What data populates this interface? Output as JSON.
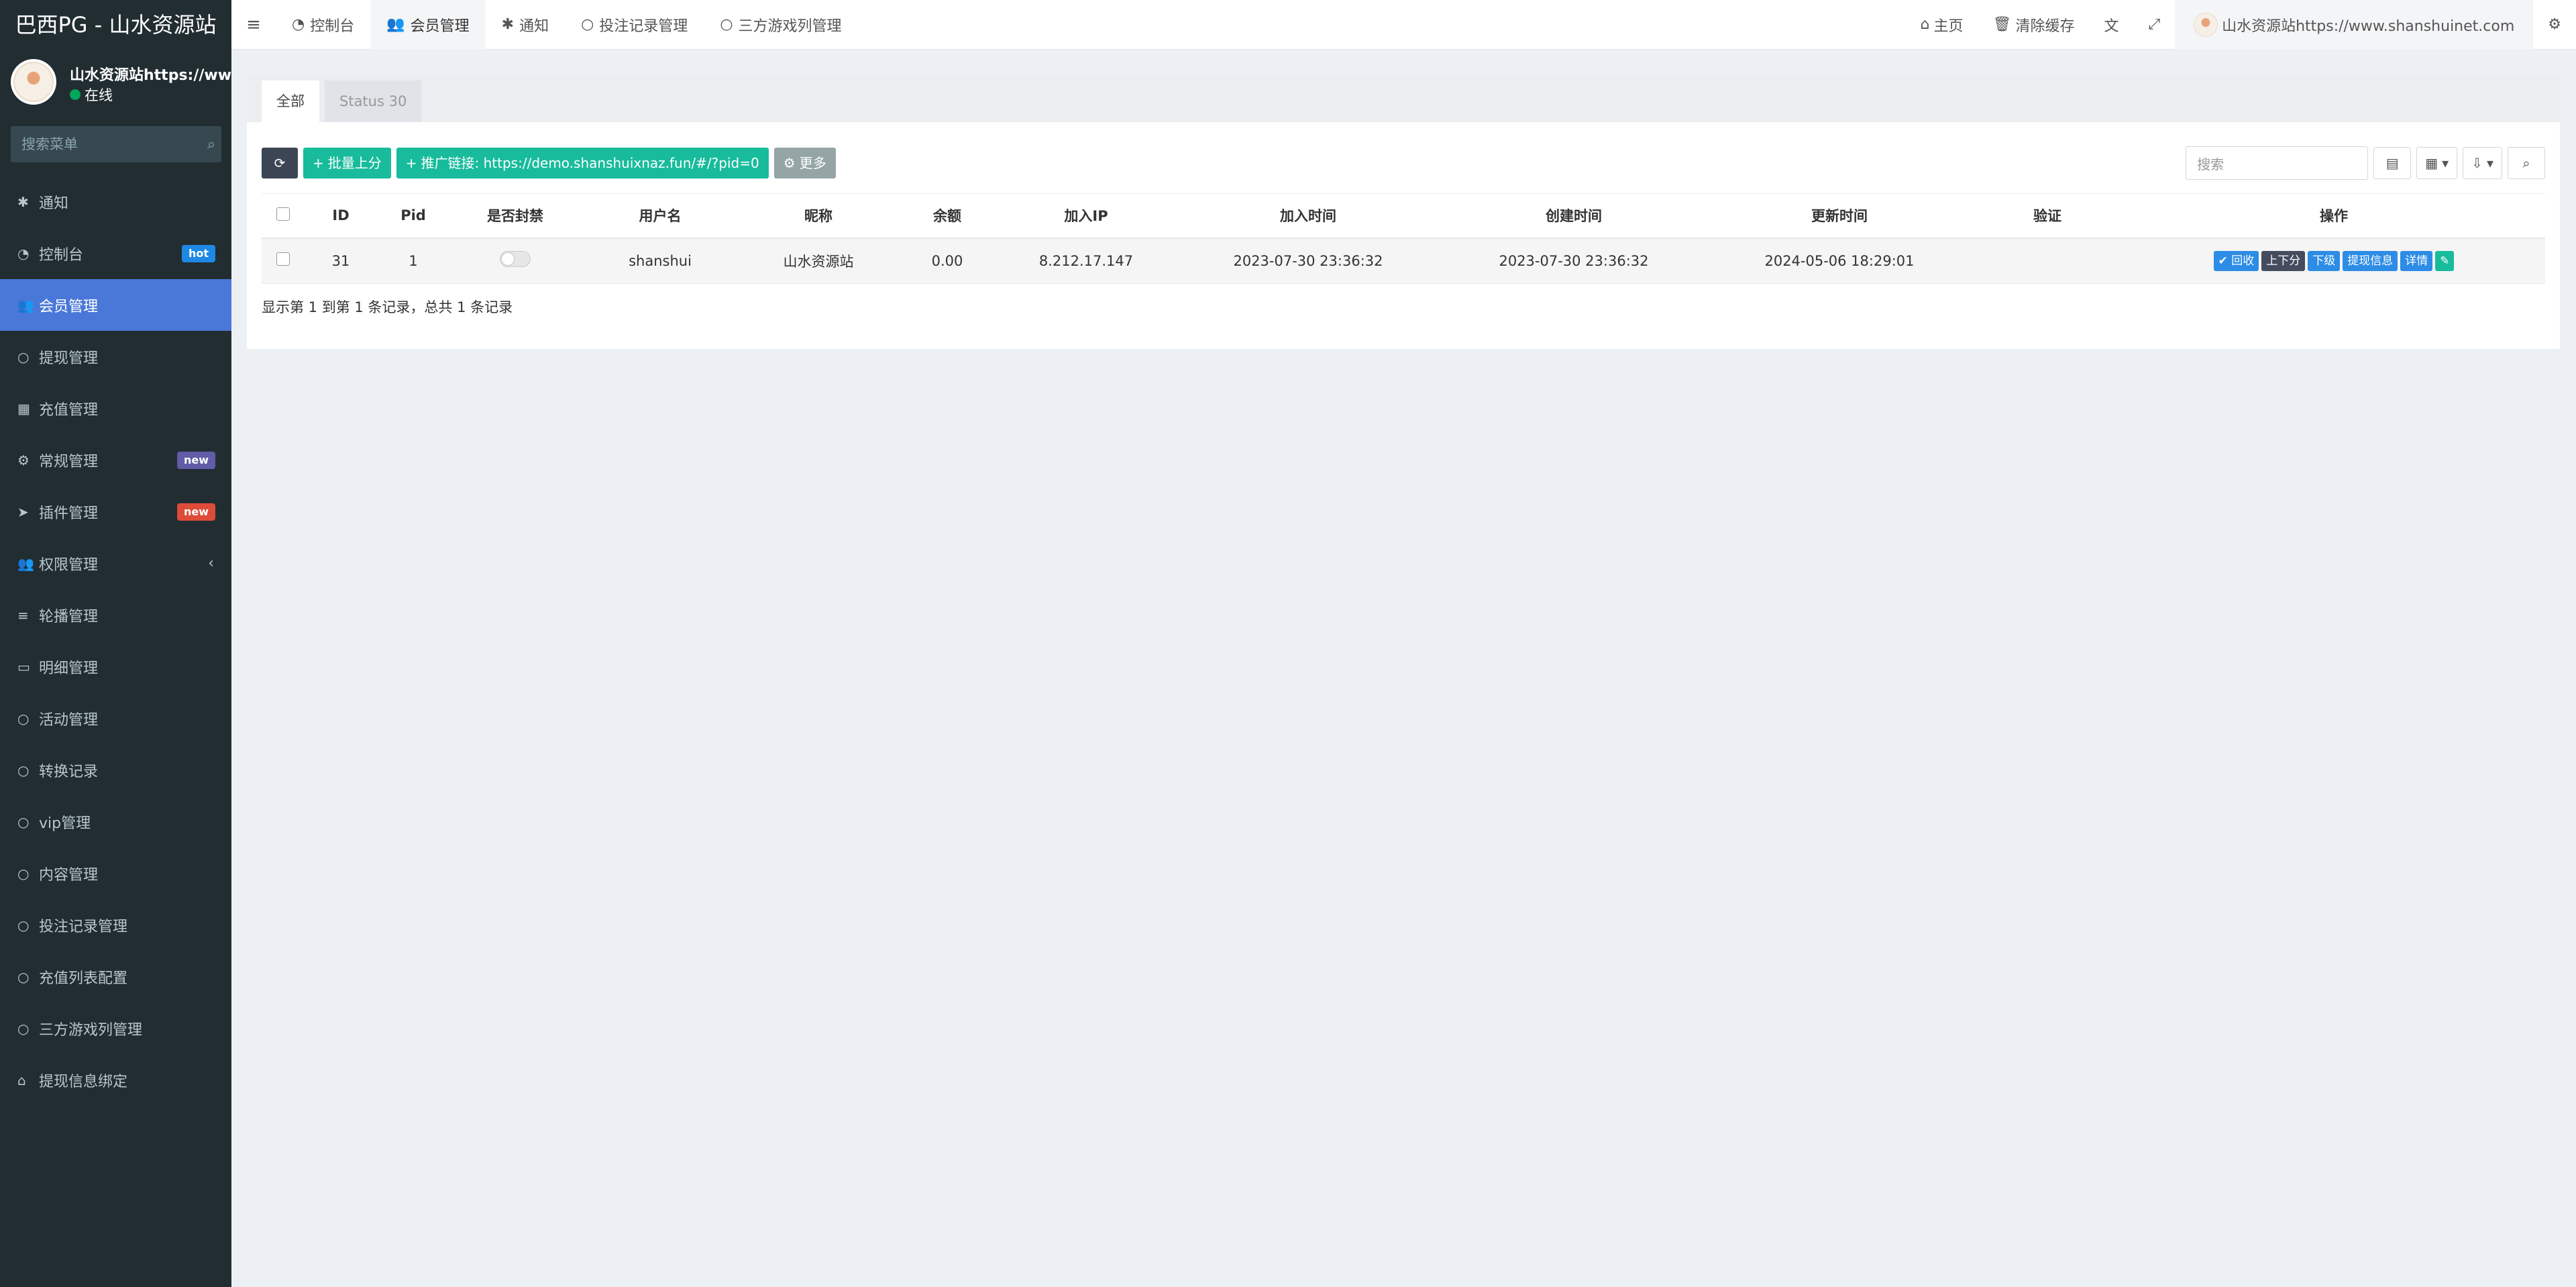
{
  "brand": "巴西PG - 山水资源站",
  "user": {
    "name": "山水资源站https://www.s",
    "status": "在线"
  },
  "sidebar": {
    "search_placeholder": "搜索菜单",
    "items": [
      {
        "label": "通知",
        "icon": "asterisk-icon"
      },
      {
        "label": "控制台",
        "icon": "dashboard-icon",
        "badge": "hot",
        "badge_color": "#1e88e5"
      },
      {
        "label": "会员管理",
        "icon": "users-icon",
        "active": true
      },
      {
        "label": "提现管理",
        "icon": "circle-icon"
      },
      {
        "label": "充值管理",
        "icon": "grid-icon"
      },
      {
        "label": "常规管理",
        "icon": "cogs-icon",
        "badge": "new",
        "badge_color": "#605ca8"
      },
      {
        "label": "插件管理",
        "icon": "rocket-icon",
        "badge": "new",
        "badge_color": "#dd4b39"
      },
      {
        "label": "权限管理",
        "icon": "group-icon",
        "chevron": "‹"
      },
      {
        "label": "轮播管理",
        "icon": "list-icon"
      },
      {
        "label": "明细管理",
        "icon": "calendar-icon"
      },
      {
        "label": "活动管理",
        "icon": "circle-icon"
      },
      {
        "label": "转换记录",
        "icon": "circle-icon"
      },
      {
        "label": "vip管理",
        "icon": "circle-icon"
      },
      {
        "label": "内容管理",
        "icon": "circle-icon"
      },
      {
        "label": "投注记录管理",
        "icon": "circle-icon"
      },
      {
        "label": "充值列表配置",
        "icon": "circle-icon"
      },
      {
        "label": "三方游戏列管理",
        "icon": "circle-icon"
      },
      {
        "label": "提现信息绑定",
        "icon": "bank-icon"
      }
    ]
  },
  "navbar": {
    "tabs": [
      {
        "label": "控制台",
        "icon": "dashboard-icon"
      },
      {
        "label": "会员管理",
        "icon": "users-icon",
        "active": true
      },
      {
        "label": "通知",
        "icon": "asterisk-icon"
      },
      {
        "label": "投注记录管理",
        "icon": "circle-icon"
      },
      {
        "label": "三方游戏列管理",
        "icon": "circle-icon"
      }
    ],
    "home": "主页",
    "clear_cache": "清除缓存",
    "user_label": "山水资源站https://www.shanshuinet.com"
  },
  "content": {
    "tabs": [
      {
        "label": "全部",
        "active": true
      },
      {
        "label": "Status 30"
      }
    ],
    "toolbar": {
      "batch_label": "批量上分",
      "promo_label": "推广链接: https://demo.shanshuixnaz.fun/#/?pid=0",
      "more_label": "更多"
    },
    "search_placeholder": "搜索",
    "columns": [
      "ID",
      "Pid",
      "是否封禁",
      "用户名",
      "昵称",
      "余额",
      "加入IP",
      "加入时间",
      "创建时间",
      "更新时间",
      "验证",
      "操作"
    ],
    "rows": [
      {
        "id": "31",
        "pid": "1",
        "banned": false,
        "username": "shanshui",
        "nickname": "山水资源站",
        "balance": "0.00",
        "join_ip": "8.212.17.147",
        "join_time": "2023-07-30 23:36:32",
        "create_time": "2023-07-30 23:36:32",
        "update_time": "2024-05-06 18:29:01",
        "verify": ""
      }
    ],
    "row_actions": {
      "recycle": "回收",
      "adjust": "上下分",
      "subordinate": "下级",
      "withdraw_info": "提现信息",
      "detail": "详情"
    },
    "footer": "显示第 1 到第 1 条记录，总共 1 条记录"
  }
}
